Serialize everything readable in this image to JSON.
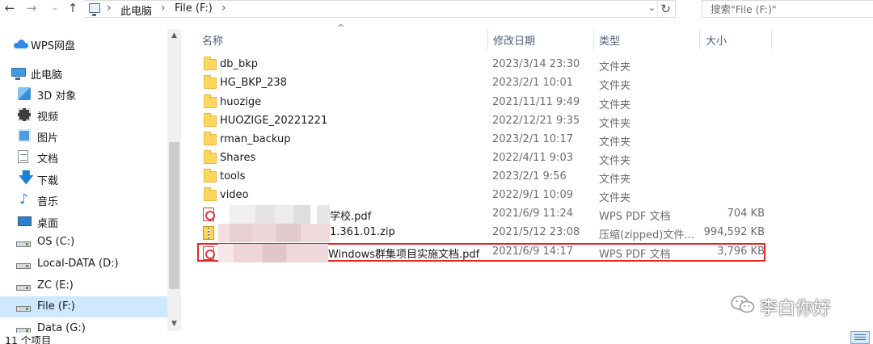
{
  "address_bar": {
    "breadcrumb": [
      "此电脑",
      "File (F:)"
    ],
    "search_placeholder": "搜索\"File (F:)\""
  },
  "nav": {
    "items": [
      {
        "label": "WPS网盘",
        "icon": "cloud-icon"
      },
      {
        "label": "此电脑",
        "icon": "computer-icon"
      },
      {
        "label": "3D 对象",
        "icon": "3d-objects-icon"
      },
      {
        "label": "视频",
        "icon": "video-icon"
      },
      {
        "label": "图片",
        "icon": "pictures-icon"
      },
      {
        "label": "文档",
        "icon": "documents-icon"
      },
      {
        "label": "下载",
        "icon": "download-icon"
      },
      {
        "label": "音乐",
        "icon": "music-icon"
      },
      {
        "label": "桌面",
        "icon": "desktop-icon"
      },
      {
        "label": "OS (C:)",
        "icon": "os-drive-icon"
      },
      {
        "label": "Local-DATA (D:)",
        "icon": "drive-icon"
      },
      {
        "label": "ZC (E:)",
        "icon": "drive-icon"
      },
      {
        "label": "File (F:)",
        "icon": "drive-icon",
        "selected": true
      },
      {
        "label": "Data (G:)",
        "icon": "drive-icon"
      }
    ]
  },
  "columns": {
    "name": "名称",
    "modified": "修改日期",
    "type": "类型",
    "size": "大小"
  },
  "files": [
    {
      "name": "db_bkp",
      "modified": "2023/3/14 23:30",
      "type": "文件夹",
      "size": "",
      "icon": "folder-icon"
    },
    {
      "name": "HG_BKP_238",
      "modified": "2023/2/1 10:01",
      "type": "文件夹",
      "size": "",
      "icon": "folder-icon"
    },
    {
      "name": "huozige",
      "modified": "2021/11/11 9:49",
      "type": "文件夹",
      "size": "",
      "icon": "folder-icon"
    },
    {
      "name": "HUOZIGE_20221221",
      "modified": "2022/12/21 9:35",
      "type": "文件夹",
      "size": "",
      "icon": "folder-icon"
    },
    {
      "name": "rman_backup",
      "modified": "2023/2/1 10:17",
      "type": "文件夹",
      "size": "",
      "icon": "folder-icon"
    },
    {
      "name": "Shares",
      "modified": "2022/4/11 9:03",
      "type": "文件夹",
      "size": "",
      "icon": "folder-icon"
    },
    {
      "name": "tools",
      "modified": "2023/2/1 9:56",
      "type": "文件夹",
      "size": "",
      "icon": "folder-icon"
    },
    {
      "name": "video",
      "modified": "2022/9/1 10:09",
      "type": "文件夹",
      "size": "",
      "icon": "folder-icon"
    },
    {
      "name": "学校.pdf",
      "modified": "2021/6/9 11:24",
      "type": "WPS PDF 文档",
      "size": "704 KB",
      "icon": "pdf-icon"
    },
    {
      "name": "1.361.01.zip",
      "modified": "2021/5/12 23:08",
      "type": "压缩(zipped)文件...",
      "size": "994,592 KB",
      "icon": "zip-icon"
    },
    {
      "name": "Windows群集项目实施文档.pdf",
      "modified": "2021/6/9 14:17",
      "type": "WPS PDF 文档",
      "size": "3,796 KB",
      "icon": "pdf-icon",
      "highlighted": true
    }
  ],
  "status_bar": {
    "item_count": "11 个项目"
  },
  "watermark": {
    "text": "李白你好"
  },
  "colors": {
    "highlight_border": "#e2242b",
    "selection": "#cde8ff",
    "header_text": "#4c607a"
  }
}
